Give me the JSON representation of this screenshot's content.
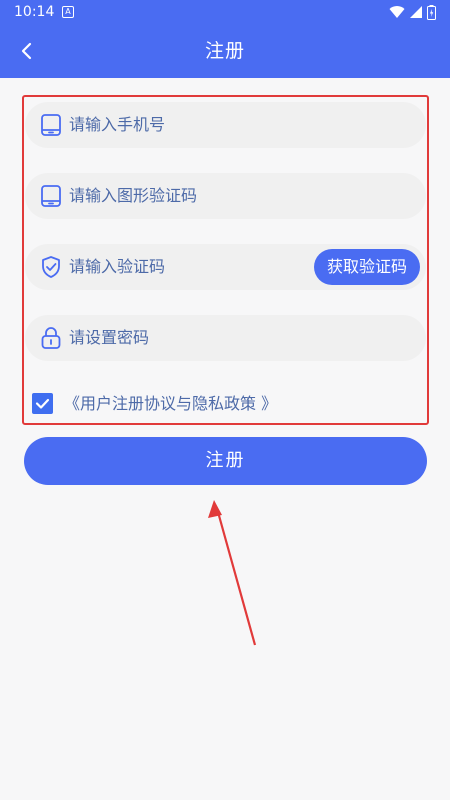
{
  "status": {
    "time": "10:14",
    "notif": "A"
  },
  "header": {
    "title": "注册"
  },
  "form": {
    "phone_placeholder": "请输入手机号",
    "captcha_placeholder": "请输入图形验证码",
    "sms_placeholder": "请输入验证码",
    "get_code_label": "获取验证码",
    "password_placeholder": "请设置密码",
    "agreement_text": "《用户注册协议与隐私政策 》",
    "agreement_checked": true
  },
  "actions": {
    "register_label": "注册"
  },
  "colors": {
    "primary": "#4a6cf2",
    "annotation": "#e13a3a"
  }
}
